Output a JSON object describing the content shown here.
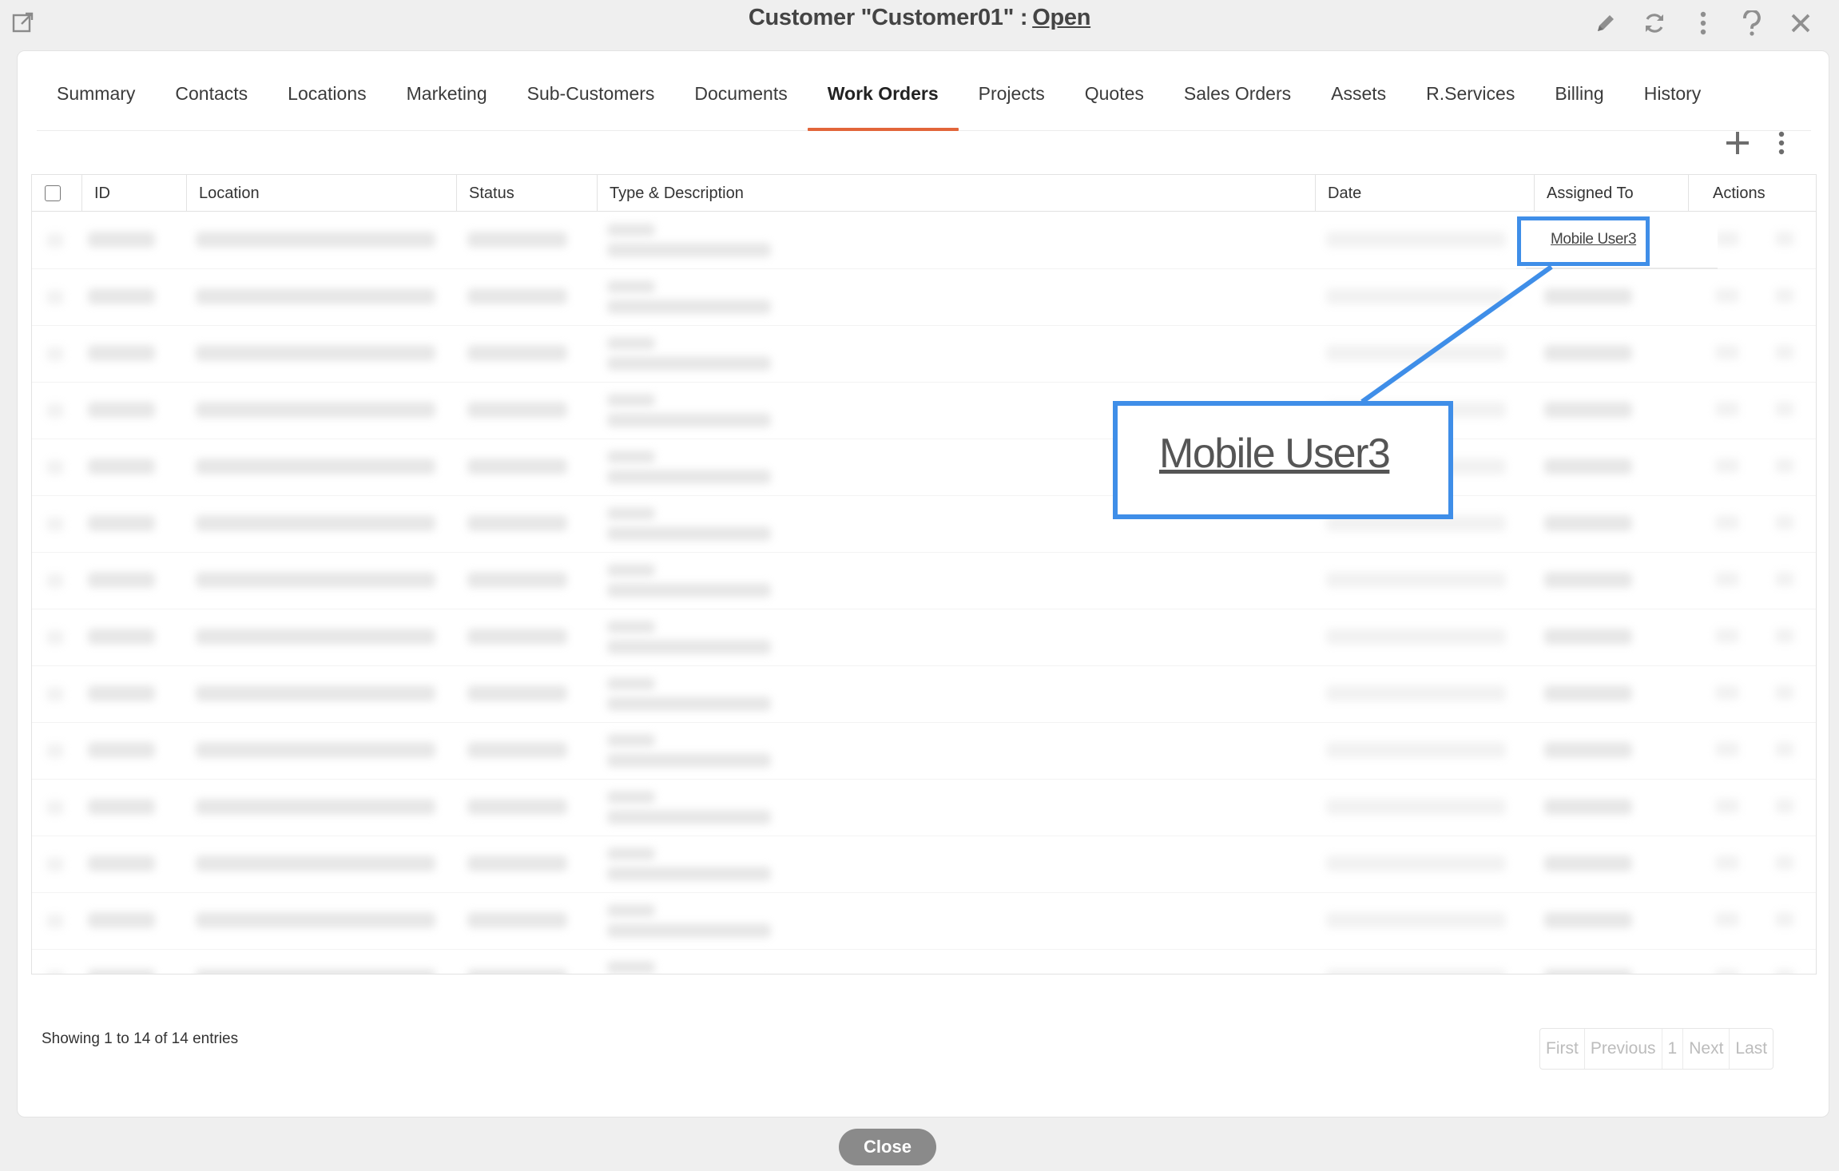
{
  "window": {
    "title_prefix": "Customer \"Customer01\" :",
    "status": "Open",
    "icons": [
      "pencil-icon",
      "refresh-icon",
      "kebab-icon",
      "help-icon",
      "close-icon"
    ]
  },
  "tabs": [
    {
      "label": "Summary"
    },
    {
      "label": "Contacts"
    },
    {
      "label": "Locations"
    },
    {
      "label": "Marketing"
    },
    {
      "label": "Sub-Customers"
    },
    {
      "label": "Documents"
    },
    {
      "label": "Work Orders",
      "active": true
    },
    {
      "label": "Projects"
    },
    {
      "label": "Quotes"
    },
    {
      "label": "Sales Orders"
    },
    {
      "label": "Assets"
    },
    {
      "label": "R.Services"
    },
    {
      "label": "Billing"
    },
    {
      "label": "History"
    }
  ],
  "table": {
    "columns": [
      "ID",
      "Location",
      "Status",
      "Type & Description",
      "Date",
      "Assigned To",
      "Actions"
    ],
    "first_row_assigned_to": "Mobile User3",
    "row_count": 14
  },
  "annotation": {
    "callout_text": "Mobile User3",
    "color": "#3f8ee8"
  },
  "footer": {
    "info": "Showing 1 to 14 of 14 entries",
    "pagination": [
      "First",
      "Previous",
      "1",
      "Next",
      "Last"
    ]
  },
  "close_button": "Close",
  "colors": {
    "active_tab_underline": "#e2653a",
    "highlight": "#3f8ee8",
    "close_button": "#8a8a8a"
  }
}
